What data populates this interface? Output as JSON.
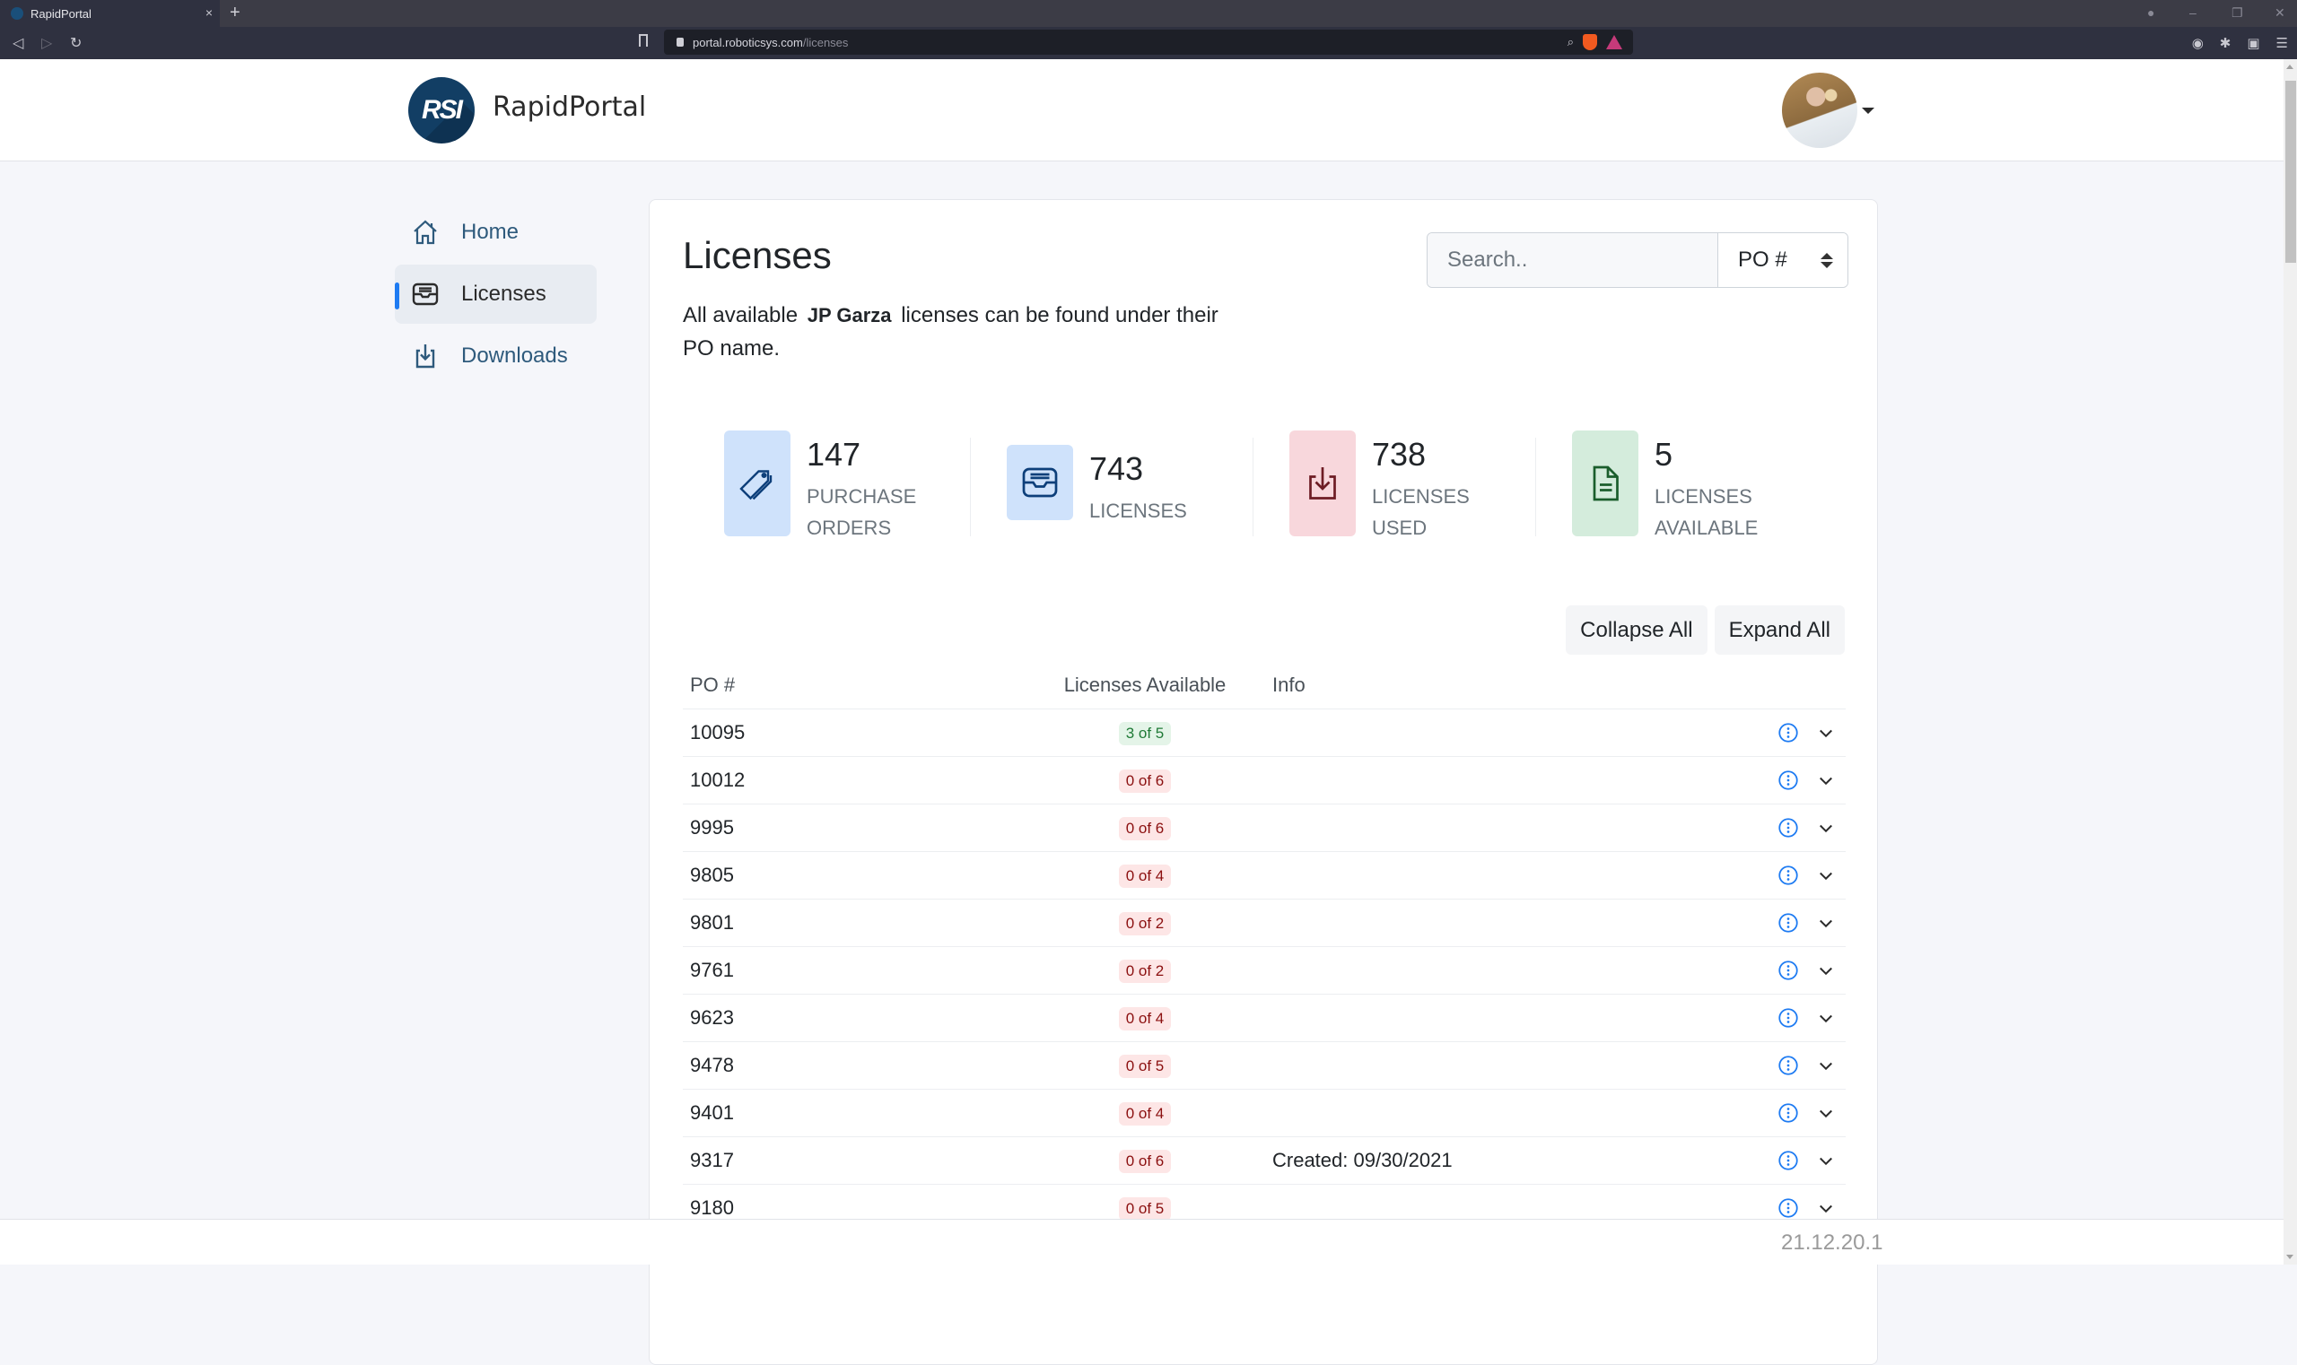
{
  "browser": {
    "tab_title": "RapidPortal",
    "tab_close": "×",
    "new_tab": "+",
    "url_domain": "portal.roboticsys.com",
    "url_path": "/licenses",
    "brave_shield_count": "1"
  },
  "header": {
    "logo_text": "RSI",
    "brand": "RapidPortal"
  },
  "sidebar": {
    "items": [
      {
        "label": "Home",
        "icon": "house-icon",
        "active": false
      },
      {
        "label": "Licenses",
        "icon": "inbox-icon",
        "active": true
      },
      {
        "label": "Downloads",
        "icon": "box-arrow-in-down-icon",
        "active": false
      }
    ]
  },
  "main": {
    "title": "Licenses",
    "description_prefix": "All available",
    "description_name": "JP Garza",
    "description_suffix": "licenses can be found under their PO name.",
    "search": {
      "placeholder": "Search..",
      "value": ""
    },
    "sort": {
      "selected": "PO #"
    },
    "stats": [
      {
        "value": "147",
        "label": "PURCHASE ORDERS",
        "icon": "tags-icon",
        "bg": "#cfe2fb",
        "fg": "#0d3f7a"
      },
      {
        "value": "743",
        "label": "LICENSES",
        "icon": "inbox-icon",
        "bg": "#cfe2fb",
        "fg": "#0d3f7a"
      },
      {
        "value": "738",
        "label": "LICENSES USED",
        "icon": "box-arrow-in-down-icon",
        "bg": "#f8d7dc",
        "fg": "#6e1c24"
      },
      {
        "value": "5",
        "label": "LICENSES AVAILABLE",
        "icon": "file-text-icon",
        "bg": "#d4ecdc",
        "fg": "#1a5e2c"
      }
    ],
    "buttons": {
      "collapse_all": "Collapse All",
      "expand_all": "Expand All"
    },
    "table": {
      "headers": {
        "po": "PO #",
        "licenses": "Licenses Available",
        "info": "Info"
      },
      "rows": [
        {
          "po": "10095",
          "licenses": "3 of 5",
          "status": "ok",
          "info": ""
        },
        {
          "po": "10012",
          "licenses": "0 of 6",
          "status": "none",
          "info": ""
        },
        {
          "po": "9995",
          "licenses": "0 of 6",
          "status": "none",
          "info": ""
        },
        {
          "po": "9805",
          "licenses": "0 of 4",
          "status": "none",
          "info": ""
        },
        {
          "po": "9801",
          "licenses": "0 of 2",
          "status": "none",
          "info": ""
        },
        {
          "po": "9761",
          "licenses": "0 of 2",
          "status": "none",
          "info": ""
        },
        {
          "po": "9623",
          "licenses": "0 of 4",
          "status": "none",
          "info": ""
        },
        {
          "po": "9478",
          "licenses": "0 of 5",
          "status": "none",
          "info": ""
        },
        {
          "po": "9401",
          "licenses": "0 of 4",
          "status": "none",
          "info": ""
        },
        {
          "po": "9317",
          "licenses": "0 of 6",
          "status": "none",
          "info": "Created: 09/30/2021"
        },
        {
          "po": "9180",
          "licenses": "0 of 5",
          "status": "none",
          "info": ""
        }
      ]
    }
  },
  "footer": {
    "version": "21.12.20.1"
  },
  "colors": {
    "accent": "#1e7bf2",
    "brand_dark": "#123e64",
    "nav_text": "#2e5a7c"
  }
}
